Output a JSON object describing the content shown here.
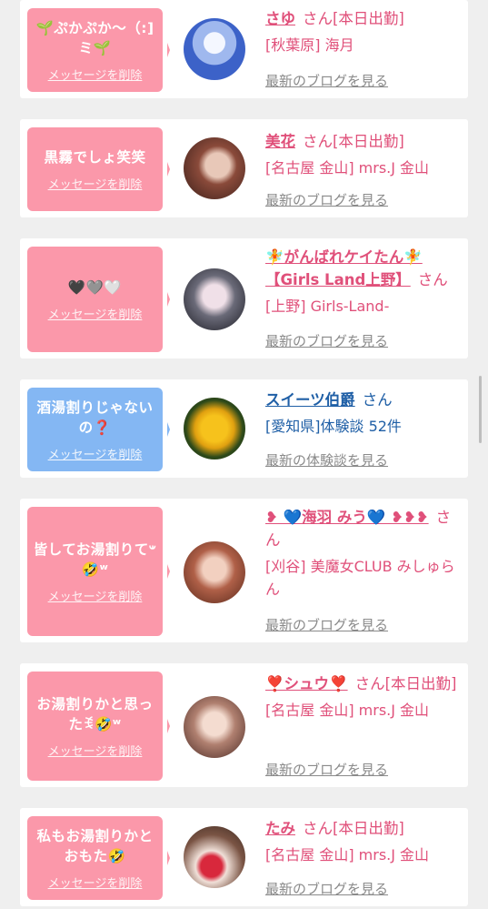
{
  "delete_label": "メッセージを削除",
  "cards": [
    {
      "message": "🌱ぷかぷか〜（:]ミ🌱",
      "name": "さゆ",
      "suffix": "さん[本日出勤]",
      "meta": "[秋葉原] 海月",
      "link": "最新のブログを見る"
    },
    {
      "message": "黒霧でしょ笑笑",
      "name": "美花",
      "suffix": "さん[本日出勤]",
      "meta": "[名古屋 金山] mrs.J 金山",
      "link": "最新のブログを見る"
    },
    {
      "message": "🖤🩶🤍",
      "name": "🧚がんばれケイたん🧚【Girls Land上野】",
      "suffix": "さん",
      "meta": "[上野] Girls-Land-",
      "link": "最新のブログを見る"
    },
    {
      "message": "酒湯割りじゃないの❓",
      "name": "スイーツ伯爵",
      "suffix": "さん",
      "meta": "[愛知県]体験談 52件",
      "link": "最新の体験談を見る"
    },
    {
      "message": "皆してお湯割りて𐤔🤣ʷ",
      "name": "❥ 💙海羽 みう💙 ❥❥❥",
      "suffix": "さん",
      "meta": "[刈谷] 美魔女CLUB みしゅらん",
      "link": "最新のブログを見る"
    },
    {
      "message": "お湯割りかと思ったꉂ🤣ʷ",
      "name": "❣️シュウ❣️",
      "suffix": "さん[本日出勤]",
      "meta": "[名古屋 金山] mrs.J 金山",
      "link": "最新のブログを見る"
    },
    {
      "message": "私もお湯割りかとおもた🤣",
      "name": "たみ",
      "suffix": "さん[本日出勤]",
      "meta": "[名古屋 金山] mrs.J 金山",
      "link": "最新のブログを見る"
    }
  ],
  "colors": {
    "pink_bubble": "#fb98aa",
    "blue_bubble": "#84b7f3",
    "pink_text": "#e0507a",
    "blue_text": "#1f5fa6",
    "link_gray": "#8a8a8a",
    "page_bg": "#efefef"
  }
}
